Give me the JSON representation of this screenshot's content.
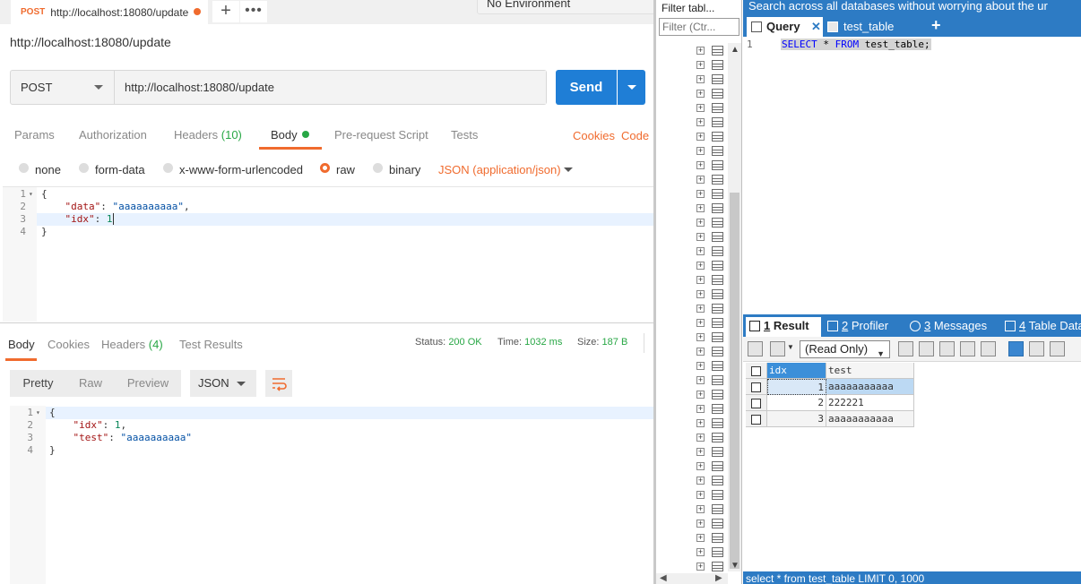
{
  "postman": {
    "tab": {
      "method": "POST",
      "url": "http://localhost:18080/update"
    },
    "environment": "No Environment",
    "title": "http://localhost:18080/update",
    "request": {
      "method": "POST",
      "url": "http://localhost:18080/update",
      "send_label": "Send"
    },
    "request_tabs": [
      {
        "label": "Params"
      },
      {
        "label": "Authorization"
      },
      {
        "label": "Headers",
        "count": "(10)"
      },
      {
        "label": "Body"
      },
      {
        "label": "Pre-request Script"
      },
      {
        "label": "Tests"
      }
    ],
    "cookies_label": "Cookies",
    "code_label": "Code",
    "body_options": [
      "none",
      "form-data",
      "x-www-form-urlencoded",
      "raw",
      "binary"
    ],
    "selected_body_option": "raw",
    "content_type": "JSON (application/json)",
    "request_body_lines": [
      {
        "n": "1",
        "text": "{"
      },
      {
        "n": "2",
        "key": "\"data\"",
        "val": "\"aaaaaaaaaa\"",
        "tail": ","
      },
      {
        "n": "3",
        "key": "\"idx\"",
        "num": "1"
      },
      {
        "n": "4",
        "text": "}"
      }
    ],
    "response_tabs": [
      {
        "label": "Body"
      },
      {
        "label": "Cookies"
      },
      {
        "label": "Headers",
        "count": "(4)"
      },
      {
        "label": "Test Results"
      }
    ],
    "status": {
      "status_label": "Status:",
      "status_value": "200 OK",
      "time_label": "Time:",
      "time_value": "1032 ms",
      "size_label": "Size:",
      "size_value": "187 B"
    },
    "view_modes": [
      "Pretty",
      "Raw",
      "Preview"
    ],
    "format": "JSON",
    "response_body_lines": [
      {
        "n": "1",
        "text": "{"
      },
      {
        "n": "2",
        "key": "\"idx\"",
        "num": "1",
        "tail": ","
      },
      {
        "n": "3",
        "key": "\"test\"",
        "val": "\"aaaaaaaaaa\""
      },
      {
        "n": "4",
        "text": "}"
      }
    ]
  },
  "navicat": {
    "filter_label": "Filter tabl...",
    "filter_placeholder": "Filter (Ctr...",
    "search_hint": "Search across all databases without worrying about the ur",
    "query_tab": "Query",
    "table_tab": "test_table",
    "sql_line_number": "1",
    "sql": {
      "kw1": "SELECT",
      "star": " * ",
      "kw2": "FROM",
      "table": " test_table;"
    },
    "result_tabs": [
      {
        "num": "1",
        "label": " Result"
      },
      {
        "num": "2",
        "label": " Profiler"
      },
      {
        "num": "3",
        "label": " Messages"
      },
      {
        "num": "4",
        "label": " Table Data"
      }
    ],
    "readonly_select": "(Read Only)",
    "columns": [
      "idx",
      "test"
    ],
    "rows": [
      {
        "idx": "1",
        "test": "aaaaaaaaaaa"
      },
      {
        "idx": "2",
        "test": "222221"
      },
      {
        "idx": "3",
        "test": "aaaaaaaaaaa"
      }
    ],
    "status_sql": "select * from test_table LIMIT 0, 1000"
  },
  "colors": {
    "postman_orange": "#f06b2e",
    "postman_blue": "#1f7ed6",
    "navicat_blue": "#2d7bc4",
    "ok_green": "#28a745"
  }
}
